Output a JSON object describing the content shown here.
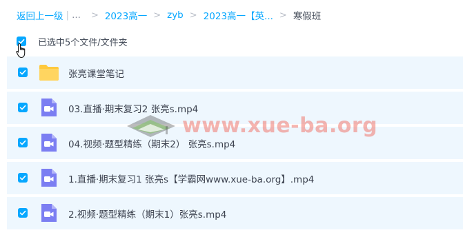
{
  "breadcrumb": {
    "back": "返回上一级",
    "ellipsis": "...",
    "items": [
      "2023高一",
      "zyb",
      "2023高一【英..."
    ],
    "current": "寒假班"
  },
  "selection": {
    "label": "已选中5个文件/文件夹",
    "all_checked": true
  },
  "files": [
    {
      "name": "张亮课堂笔记",
      "type": "folder",
      "checked": true
    },
    {
      "name": "03.直播·期末复习2 张亮s.mp4",
      "type": "video",
      "checked": true
    },
    {
      "name": "04.视频·题型精练（期末2） 张亮s.mp4",
      "type": "video",
      "checked": true
    },
    {
      "name": "1.直播·期末复习1 张亮s【学霸网www.xue-ba.org】.mp4",
      "type": "video",
      "checked": true
    },
    {
      "name": "2.视频·题型精练（期末1）张亮s.mp4",
      "type": "video",
      "checked": true
    }
  ],
  "watermark": {
    "text": "www.xue-ba.org"
  },
  "colors": {
    "accent": "#06a7ff",
    "row_selected_bg": "#eef7fe",
    "folder": "#ffc93d",
    "video": "#7b7ef2"
  }
}
